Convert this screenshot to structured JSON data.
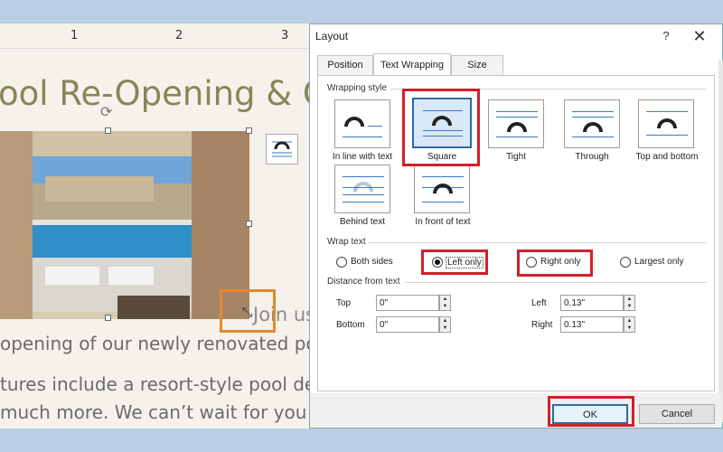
{
  "document": {
    "ruler_numbers": [
      "1",
      "2",
      "3"
    ],
    "title": "ool Re-Opening & Ce",
    "join_text": "Join us",
    "body_lines": [
      "opening of our newly renovated pool!",
      "tures include a resort-style pool deck,",
      " much more. We can’t wait for you to"
    ]
  },
  "dialog": {
    "title": "Layout",
    "help": "?",
    "close": "✕",
    "tabs": [
      {
        "label": "Position",
        "active": false
      },
      {
        "label": "Text Wrapping",
        "active": true
      },
      {
        "label": "Size",
        "active": false
      }
    ],
    "wrapping_style": {
      "heading": "Wrapping style",
      "options": [
        {
          "label": "In line with text",
          "selected": false
        },
        {
          "label": "Square",
          "selected": true
        },
        {
          "label": "Tight",
          "selected": false
        },
        {
          "label": "Through",
          "selected": false
        },
        {
          "label": "Top and bottom",
          "selected": false
        },
        {
          "label": "Behind text",
          "selected": false
        },
        {
          "label": "In front of text",
          "selected": false
        }
      ]
    },
    "wrap_text": {
      "heading": "Wrap text",
      "options": [
        {
          "label": "Both sides",
          "checked": false
        },
        {
          "label": "Left only",
          "checked": true
        },
        {
          "label": "Right only",
          "checked": false
        },
        {
          "label": "Largest only",
          "checked": false
        }
      ]
    },
    "distance": {
      "heading": "Distance from text",
      "top_label": "Top",
      "top_value": "0\"",
      "bottom_label": "Bottom",
      "bottom_value": "0\"",
      "left_label": "Left",
      "left_value": "0.13\"",
      "right_label": "Right",
      "right_value": "0.13\""
    },
    "ok_label": "OK",
    "cancel_label": "Cancel"
  },
  "colors": {
    "highlight_red": "#d0202a",
    "highlight_orange": "#e8872b",
    "accent_blue": "#2b6aa8"
  }
}
